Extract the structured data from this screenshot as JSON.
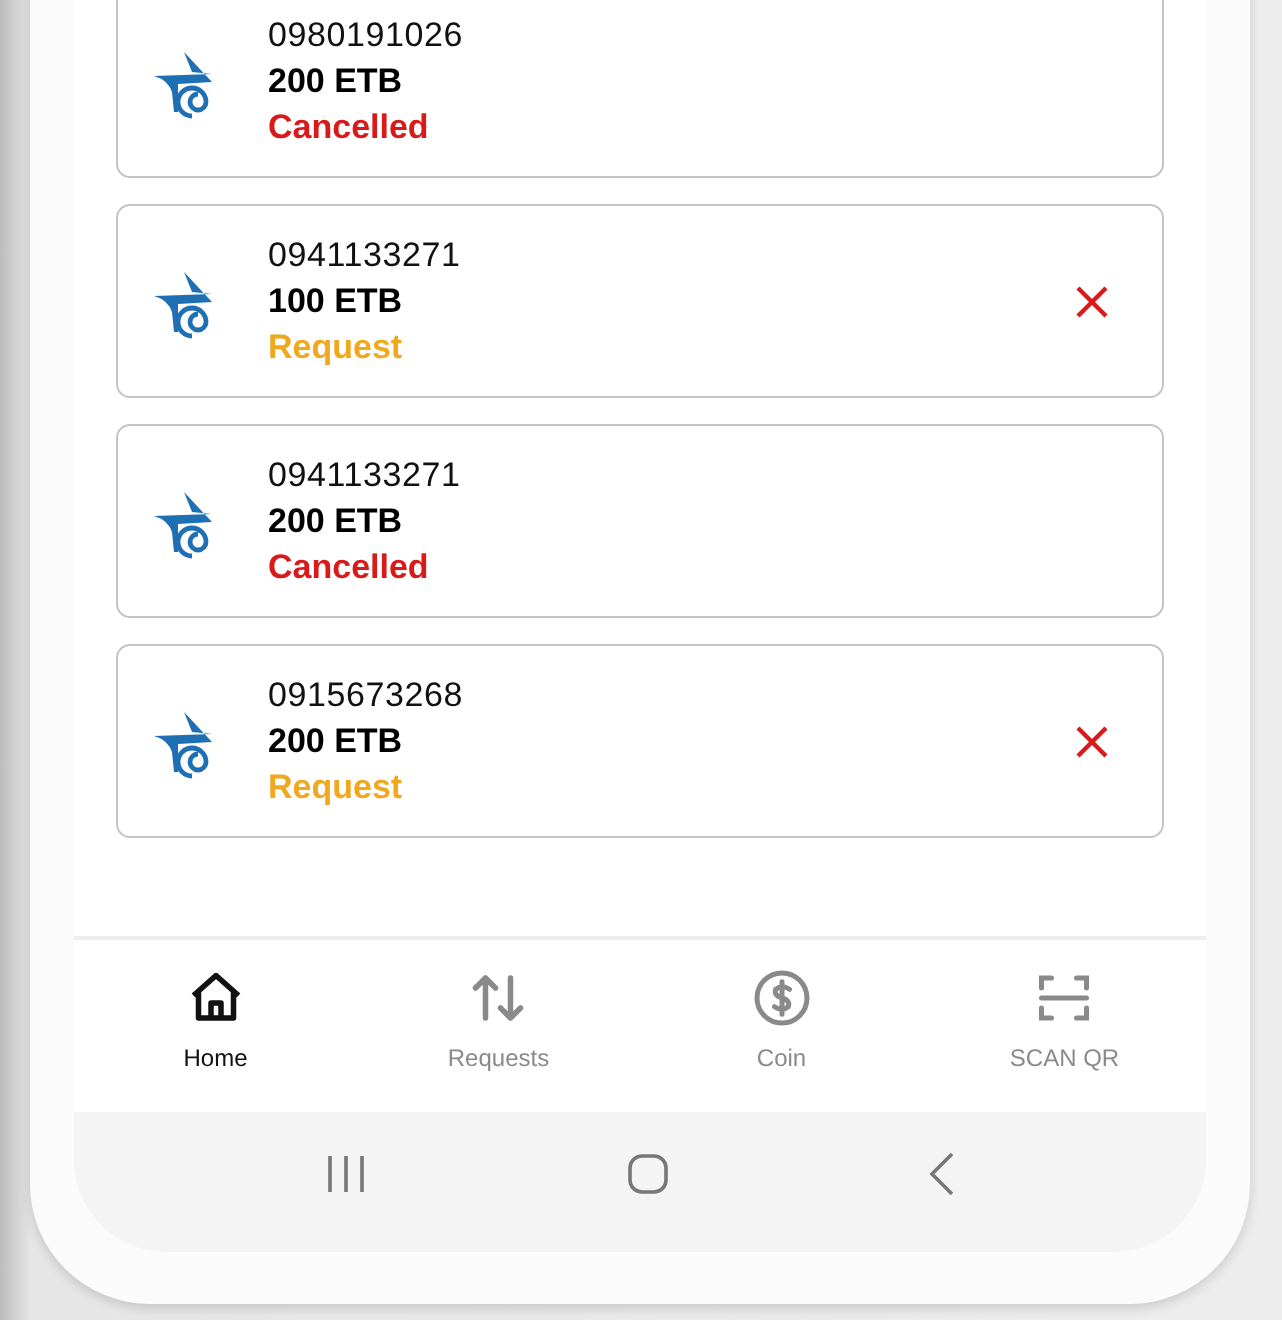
{
  "transactions": [
    {
      "phone": "0980191026",
      "amount": "200 ETB",
      "status": "Cancelled",
      "kind": "cancelled",
      "cancellable": false
    },
    {
      "phone": "0941133271",
      "amount": "100 ETB",
      "status": "Request",
      "kind": "request",
      "cancellable": true
    },
    {
      "phone": "0941133271",
      "amount": "200 ETB",
      "status": "Cancelled",
      "kind": "cancelled",
      "cancellable": false
    },
    {
      "phone": "0915673268",
      "amount": "200 ETB",
      "status": "Request",
      "kind": "request",
      "cancellable": true
    }
  ],
  "bottom_nav": [
    {
      "label": "Home",
      "kind": "home",
      "selected": true
    },
    {
      "label": "Requests",
      "kind": "swap",
      "selected": false
    },
    {
      "label": "Coin",
      "kind": "coin",
      "selected": false
    },
    {
      "label": "SCAN QR",
      "kind": "scan",
      "selected": false
    }
  ]
}
